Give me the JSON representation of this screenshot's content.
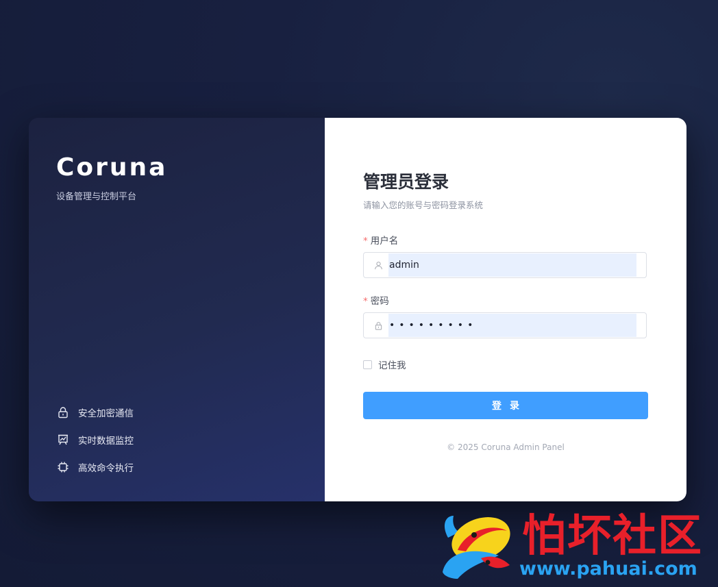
{
  "brand": {
    "name": "Coruna",
    "subtitle": "设备管理与控制平台"
  },
  "features": [
    {
      "icon": "lock-icon",
      "label": "安全加密通信"
    },
    {
      "icon": "chart-board-icon",
      "label": "实时数据监控"
    },
    {
      "icon": "chip-icon",
      "label": "高效命令执行"
    }
  ],
  "login": {
    "title": "管理员登录",
    "subtitle": "请输入您的账号与密码登录系统",
    "username": {
      "label": "用户名",
      "required": "*",
      "value": "admin",
      "icon": "user-icon"
    },
    "password": {
      "label": "密码",
      "required": "*",
      "masked_value": "•••••••••",
      "icon": "lock-icon"
    },
    "remember_label": "记住我",
    "remember_checked": false,
    "submit_label": "登录",
    "footer": "© 2025 Coruna Admin Panel"
  },
  "watermark": {
    "text": "怕坏社区",
    "url": "www.pahuai.com"
  },
  "colors": {
    "accent": "#409eff",
    "required": "#f56c6c",
    "autofill": "#e8f0fe",
    "watermark_red": "#e8202a",
    "watermark_blue": "#2aa3f2"
  }
}
